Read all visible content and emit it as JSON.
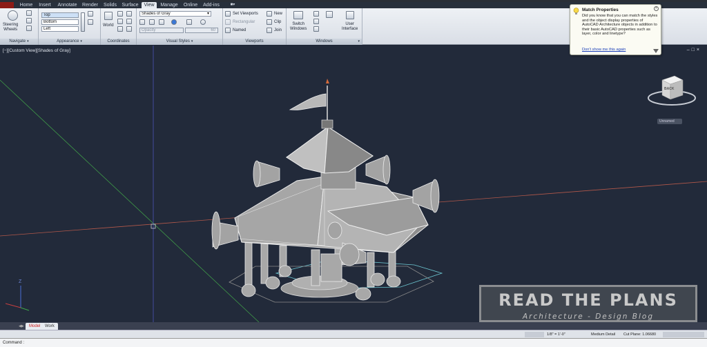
{
  "tabs": [
    "Home",
    "Insert",
    "Annotate",
    "Render",
    "Solids",
    "Surface",
    "View",
    "Manage",
    "Online",
    "Add-ins"
  ],
  "active_tab": "View",
  "navigate": {
    "steering_label": "Steering\nWheels",
    "title": "Navigate"
  },
  "appearance": {
    "views": [
      "Top",
      "Bottom",
      "Left"
    ],
    "title": "Appearance"
  },
  "coordinates": {
    "world_label": "World",
    "title": "Coordinates"
  },
  "visual_styles": {
    "style_value": "Shades of Gray",
    "opacity_label": "Opacity",
    "opacity_value": "60",
    "title": "Visual Styles"
  },
  "viewports": {
    "set_viewports": "Set Viewports",
    "rectangular": "Rectangular",
    "named": "Named",
    "new": "New",
    "clip": "Clip",
    "join": "Join",
    "title": "Viewports"
  },
  "windows": {
    "switch_label": "Switch\nWindows",
    "user_interface": "User\nInterface",
    "title": "Windows"
  },
  "info": {
    "title": "Match Properties",
    "text": "Did you know that you can match the styles and the object display properties of AutoCAD Architecture objects in addition to their basic AutoCAD properties such as layer, color and linetype?",
    "link": "Don't show me this again"
  },
  "viewport": {
    "label": "[−][Custom View][Shades of Gray]"
  },
  "viewcube": {
    "face": "BACK",
    "unnamed": "Unnamed"
  },
  "watermark": {
    "title": "READ THE PLANS",
    "subtitle": "Architecture - Design Blog"
  },
  "layout_tabs": [
    "Model",
    "Work"
  ],
  "active_layout": "Model",
  "status": {
    "scale": "1/8\" = 1'-0\"",
    "detail": "Medium Detail",
    "cut_plane": "Cut Plane: 1.06680"
  },
  "command": {
    "label": "Command :"
  },
  "colors": {
    "ribbon": "#dfe4eb",
    "viewport_bg": "#222a3a",
    "axis_red": "#c0604a",
    "axis_green": "#3fa64a",
    "model_tab": "#cc2020",
    "link": "#1b3fb8"
  }
}
